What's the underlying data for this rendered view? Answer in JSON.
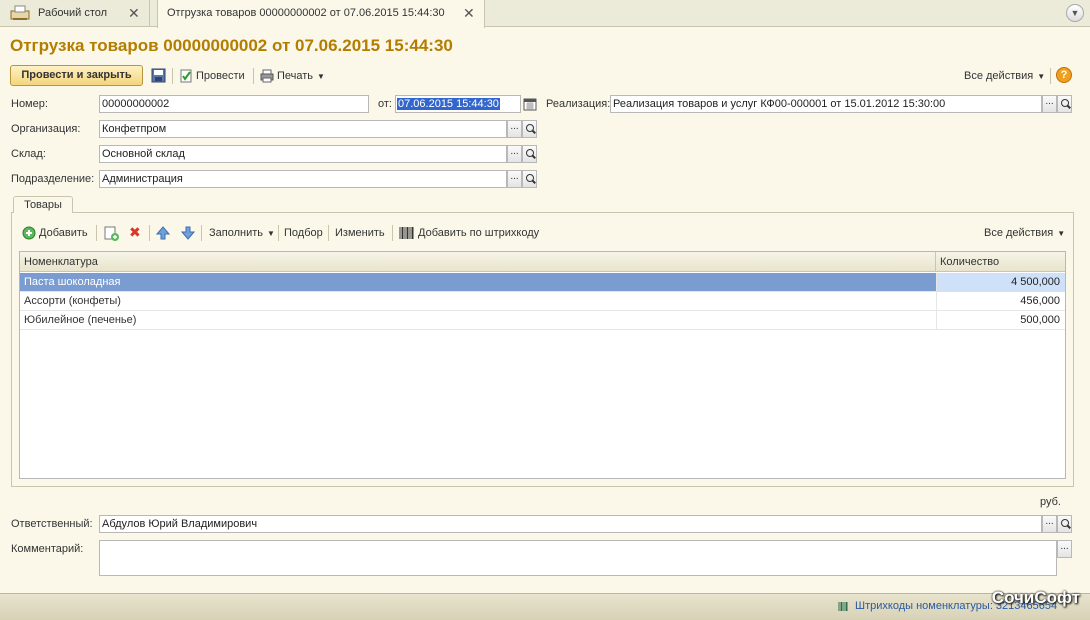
{
  "tabs": [
    {
      "label": "Рабочий стол"
    },
    {
      "label": "Отгрузка товаров 00000000002 от 07.06.2015 15:44:30"
    }
  ],
  "title": "Отгрузка товаров 00000000002 от 07.06.2015 15:44:30",
  "toolbar": {
    "post_close": "Провести и закрыть",
    "post": "Провести",
    "print": "Печать",
    "all_actions": "Все действия",
    "help": "?"
  },
  "form": {
    "number_label": "Номер:",
    "number_value": "00000000002",
    "date_label": "от:",
    "date_value": "07.06.2015 15:44:30",
    "realization_label": "Реализация:",
    "realization_value": "Реализация товаров и услуг КФ00-000001 от 15.01.2012 15:30:00",
    "org_label": "Организация:",
    "org_value": "Конфетпром",
    "warehouse_label": "Склад:",
    "warehouse_value": "Основной склад",
    "dept_label": "Подразделение:",
    "dept_value": "Администрация",
    "responsible_label": "Ответственный:",
    "responsible_value": "Абдулов Юрий Владимирович",
    "comment_label": "Комментарий:",
    "comment_value": "",
    "currency": "руб.",
    "dots": "..."
  },
  "goods": {
    "tab_label": "Товары",
    "toolbar": {
      "add": "Добавить",
      "fill": "Заполнить",
      "pick": "Подбор",
      "edit": "Изменить",
      "add_barcode": "Добавить по штрихкоду",
      "all_actions": "Все действия"
    },
    "columns": [
      "Номенклатура",
      "Количество"
    ],
    "rows": [
      {
        "name": "Паста шоколадная",
        "qty": "4 500,000"
      },
      {
        "name": "Ассорти (конфеты)",
        "qty": "456,000"
      },
      {
        "name": "Юбилейное (печенье)",
        "qty": "500,000"
      }
    ]
  },
  "status": {
    "link": "Штрихкоды номенклатуры: 3213465654"
  },
  "watermark": "СочиСофт"
}
